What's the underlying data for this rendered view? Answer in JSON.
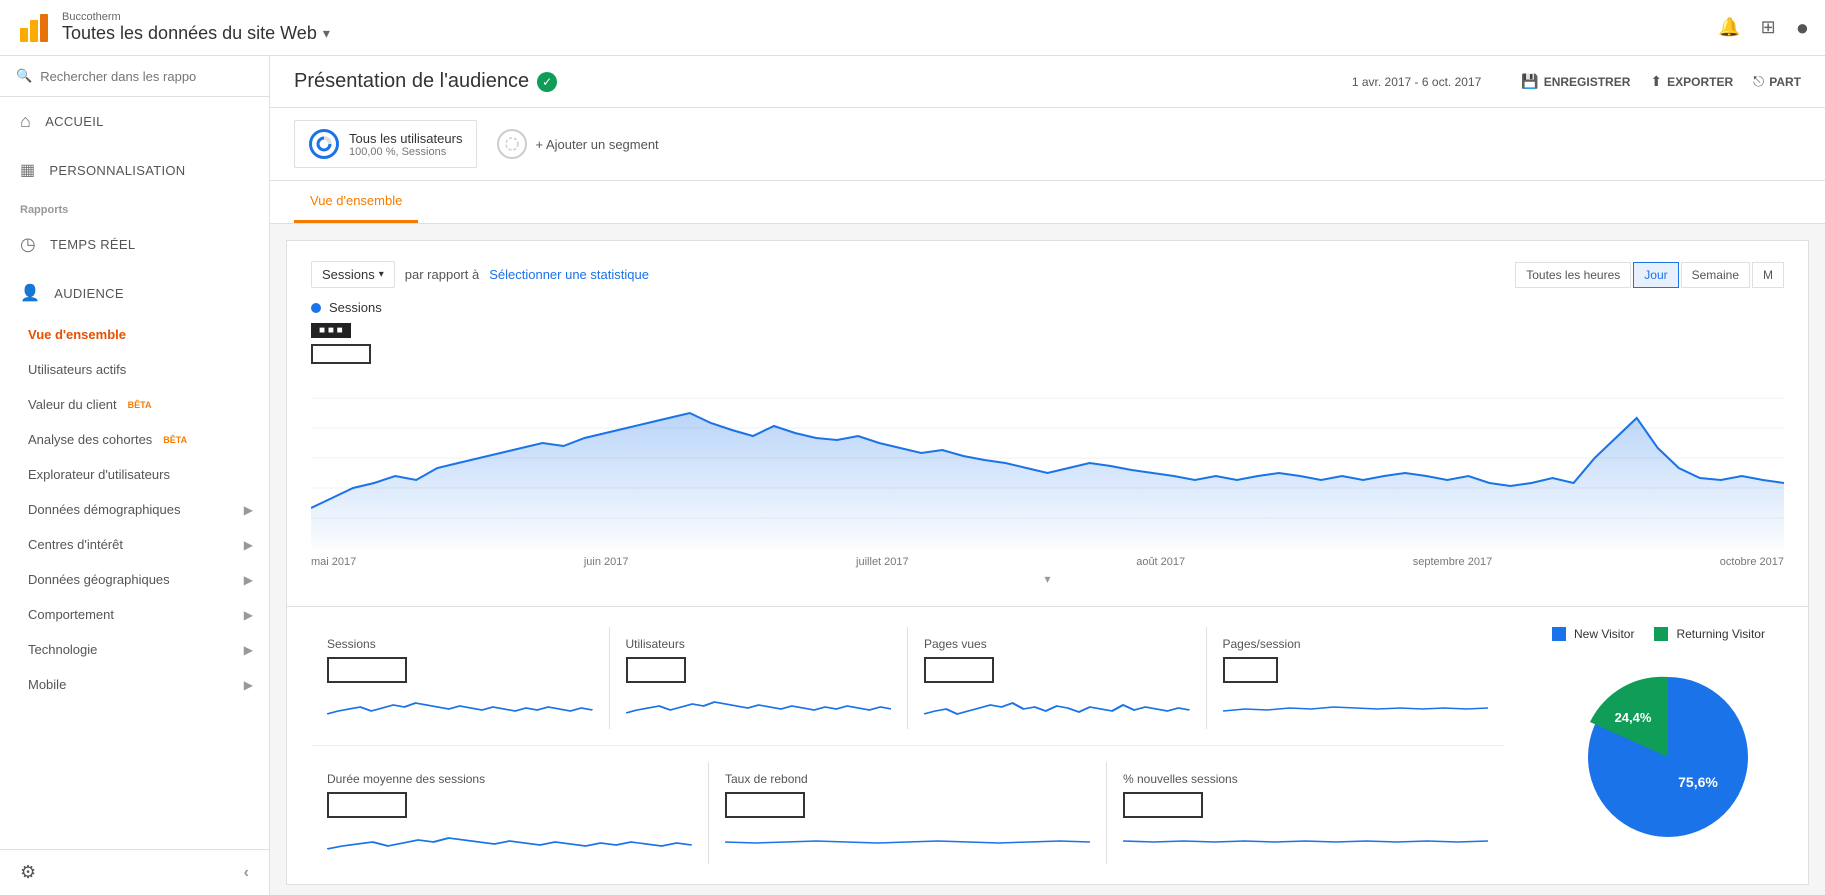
{
  "brand": {
    "name": "Buccotherm",
    "site_selector": "Toutes les données du site Web",
    "arrow": "▾"
  },
  "header_icons": {
    "bell": "🔔",
    "grid": "⊞",
    "account": "⊙"
  },
  "sidebar": {
    "search_placeholder": "Rechercher dans les rappo",
    "nav_items": [
      {
        "label": "ACCUEIL",
        "icon": "⌂"
      },
      {
        "label": "PERSONNALISATION",
        "icon": "▦"
      }
    ],
    "reports_label": "Rapports",
    "reports_items": [
      {
        "label": "TEMPS RÉEL",
        "icon": "◷"
      },
      {
        "label": "AUDIENCE",
        "icon": "👤",
        "active": false
      }
    ],
    "audience_sub": [
      {
        "label": "Vue d'ensemble",
        "active": true
      },
      {
        "label": "Utilisateurs actifs"
      },
      {
        "label": "Valeur du client",
        "badge": "BÊTA"
      },
      {
        "label": "Analyse des cohortes",
        "badge": "BÊTA"
      },
      {
        "label": "Explorateur d'utilisateurs"
      }
    ],
    "audience_expandable": [
      {
        "label": "Données démographiques"
      },
      {
        "label": "Centres d'intérêt"
      },
      {
        "label": "Données géographiques"
      },
      {
        "label": "Comportement"
      },
      {
        "label": "Technologie"
      },
      {
        "label": "Mobile"
      }
    ],
    "settings_icon": "⚙",
    "collapse_icon": "‹"
  },
  "main": {
    "title": "Présentation de l'audience",
    "verified_icon": "✓",
    "actions": [
      {
        "label": "ENREGISTRER",
        "icon": "💾"
      },
      {
        "label": "EXPORTER",
        "icon": "⬆"
      },
      {
        "label": "PART",
        "icon": "⎋"
      }
    ],
    "date_range": "1 avr. 2017 - 6 oct. 2017"
  },
  "segments": {
    "all_users_label": "Tous les utilisateurs",
    "all_users_desc": "100,00 %, Sessions",
    "add_segment_label": "+ Ajouter un segment"
  },
  "tabs": [
    {
      "label": "Vue d'ensemble",
      "active": true
    }
  ],
  "chart": {
    "metric_label": "Sessions",
    "compare_label": "par rapport à",
    "select_stat_label": "Sélectionner une statistique",
    "time_buttons": [
      {
        "label": "Toutes les heures",
        "active": false
      },
      {
        "label": "Jour",
        "active": true
      },
      {
        "label": "Semaine",
        "active": false
      },
      {
        "label": "M",
        "active": false
      }
    ],
    "legend_label": "Sessions",
    "x_axis_labels": [
      "mai 2017",
      "juin 2017",
      "juillet 2017",
      "août 2017",
      "septembre 2017",
      "octobre 2017"
    ],
    "chart_color": "#1a73e8",
    "chart_fill": "rgba(26,115,232,0.15)"
  },
  "stats": {
    "row1": [
      {
        "label": "Sessions"
      },
      {
        "label": "Utilisateurs"
      },
      {
        "label": "Pages vues"
      },
      {
        "label": "Pages/session"
      }
    ],
    "row2": [
      {
        "label": "Durée moyenne des sessions"
      },
      {
        "label": "Taux de rebond"
      },
      {
        "label": "% nouvelles sessions"
      }
    ]
  },
  "pie": {
    "legend": [
      {
        "label": "New Visitor",
        "color": "#1a73e8",
        "value": "75,6%"
      },
      {
        "label": "Returning Visitor",
        "color": "#0f9d58",
        "value": "24,4%"
      }
    ],
    "center_label_new": "75,6",
    "center_label_ret": "24,4"
  }
}
